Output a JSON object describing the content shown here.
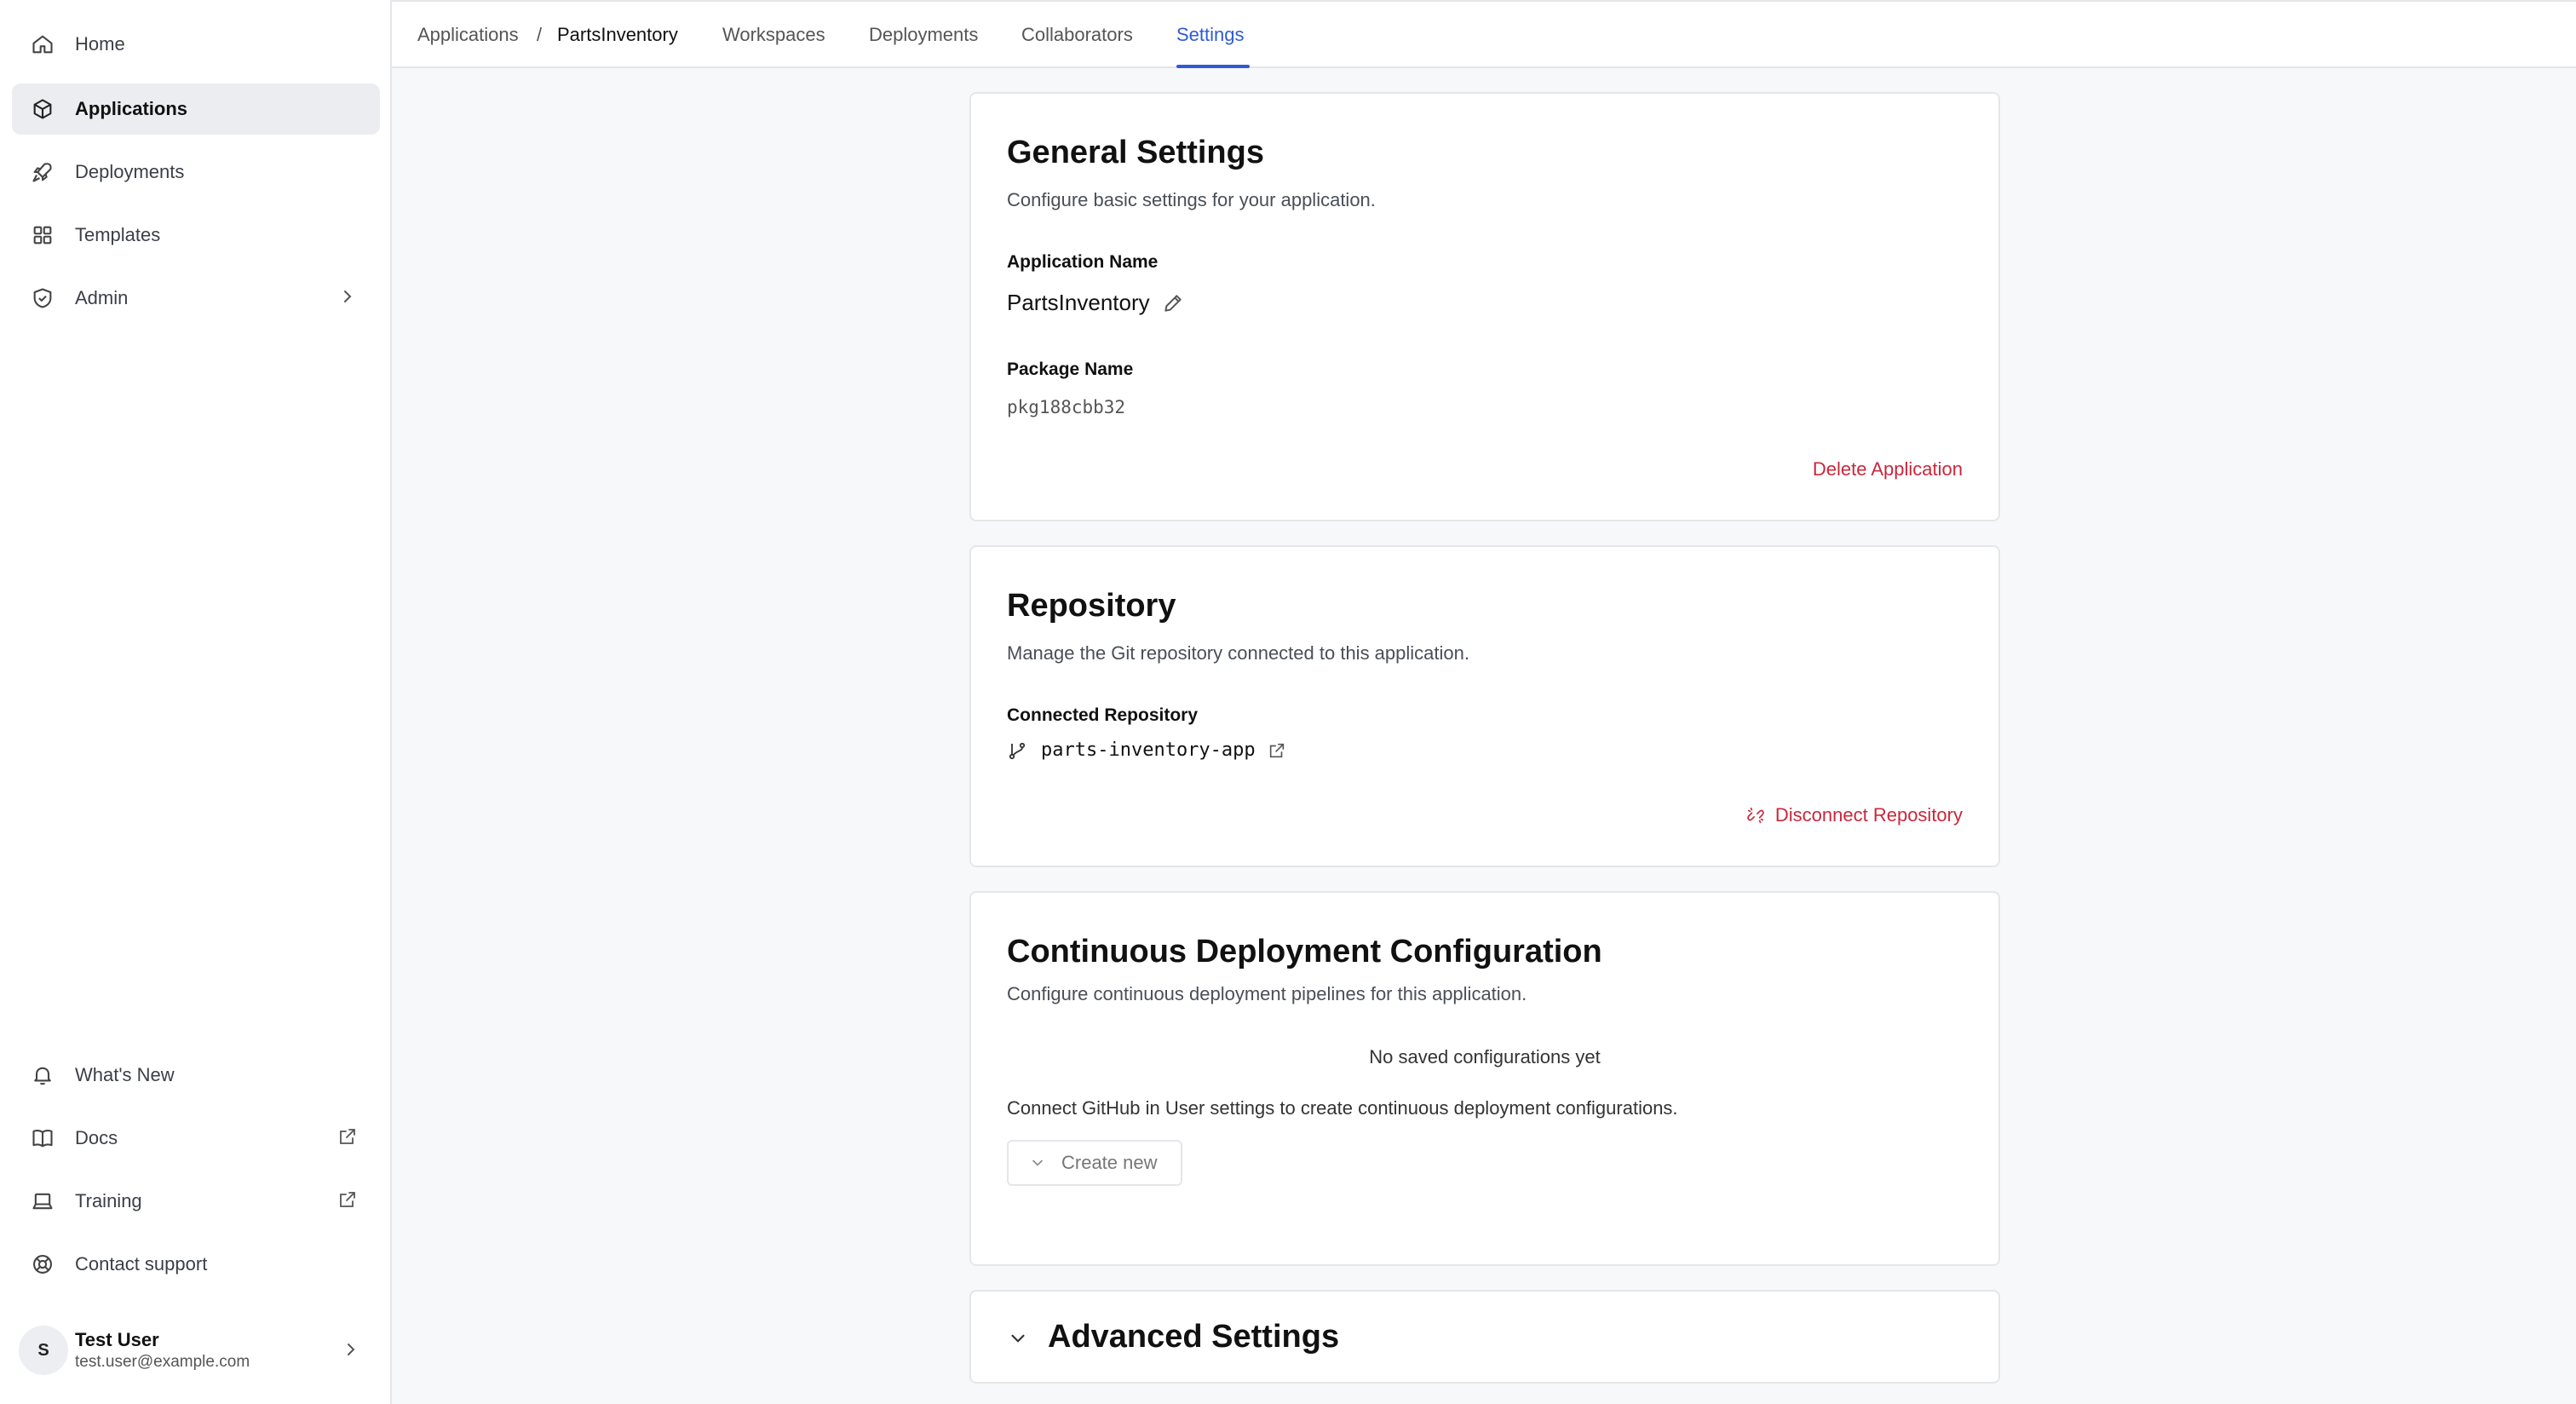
{
  "sidebar": {
    "items": [
      {
        "label": "Home",
        "icon": "home-icon"
      },
      {
        "label": "Applications",
        "icon": "cube-icon"
      },
      {
        "label": "Deployments",
        "icon": "rocket-icon"
      },
      {
        "label": "Templates",
        "icon": "grid-icon"
      },
      {
        "label": "Admin",
        "icon": "shield-icon"
      }
    ],
    "bottom_items": [
      {
        "label": "What's New",
        "icon": "bell-icon"
      },
      {
        "label": "Docs",
        "icon": "book-icon"
      },
      {
        "label": "Training",
        "icon": "laptop-icon"
      },
      {
        "label": "Contact support",
        "icon": "lifebuoy-icon"
      }
    ],
    "user": {
      "initial": "S",
      "name": "Test User",
      "email": "test.user@example.com"
    }
  },
  "topbar": {
    "breadcrumb_root": "Applications",
    "breadcrumb_sep": "/",
    "breadcrumb_current": "PartsInventory",
    "tabs": [
      "Workspaces",
      "Deployments",
      "Collaborators",
      "Settings"
    ],
    "active_tab": "Settings"
  },
  "general": {
    "title": "General Settings",
    "desc": "Configure basic settings for your application.",
    "app_name_label": "Application Name",
    "app_name": "PartsInventory",
    "package_label": "Package Name",
    "package_name": "pkg188cbb32",
    "delete_label": "Delete Application"
  },
  "repository": {
    "title": "Repository",
    "desc": "Manage the Git repository connected to this application.",
    "connected_label": "Connected Repository",
    "repo_name": "parts-inventory-app",
    "disconnect_label": "Disconnect Repository"
  },
  "cd": {
    "title": "Continuous Deployment Configuration",
    "desc": "Configure continuous deployment pipelines for this application.",
    "empty": "No saved configurations yet",
    "hint": "Connect GitHub in User settings to create continuous deployment configurations.",
    "create_label": "Create new"
  },
  "advanced": {
    "title": "Advanced Settings"
  },
  "colors": {
    "accent": "#2e5bd6",
    "danger": "#c8283c"
  }
}
